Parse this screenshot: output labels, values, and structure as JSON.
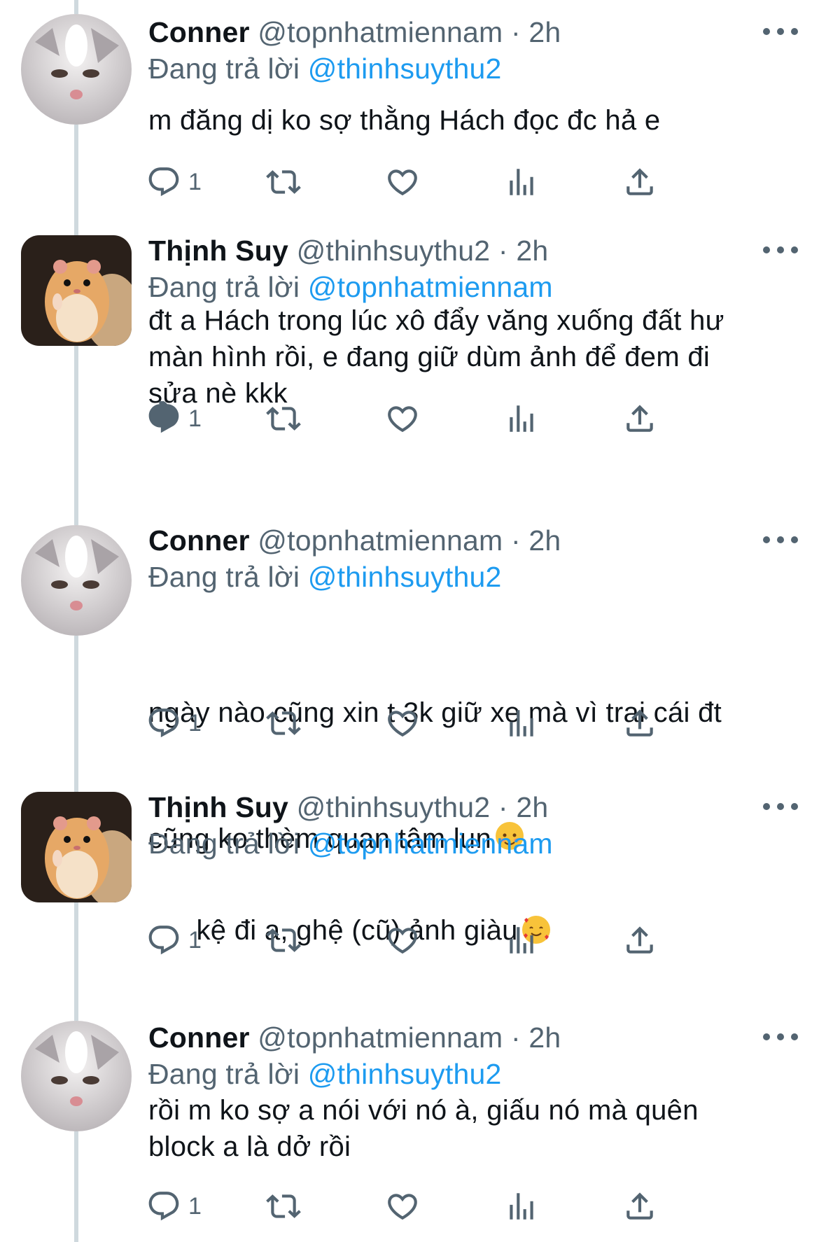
{
  "tweets": [
    {
      "name": "Conner",
      "handle": "@topnhatmiennam",
      "time": "2h",
      "reply_prefix": "Đang trả lời",
      "reply_to": "@thinhsuythu2",
      "text": "m đăng dị ko sợ thằng Hách đọc đc hả e",
      "reply_count": "1",
      "avatar": "cat-avatar"
    },
    {
      "name": "Thịnh Suy",
      "handle": "@thinhsuythu2",
      "time": "2h",
      "reply_prefix": "Đang trả lời",
      "reply_to": "@topnhatmiennam",
      "text": "đt a Hách trong lúc xô đẩy văng xuống đất hư\nmàn hình rồi, e đang giữ dùm ảnh để đem đi\nsửa nè kkk",
      "reply_count": "1",
      "avatar": "hamster-avatar"
    },
    {
      "name": "Conner",
      "handle": "@topnhatmiennam",
      "time": "2h",
      "reply_prefix": "Đang trả lời",
      "reply_to": "@thinhsuythu2",
      "text_line1": "ngày nào cũng xin t 3k giữ xe mà vì trai cái đt",
      "text_line2": "cũng ko thèm quan tâm lun",
      "emoji": "smiling-face-emoji",
      "reply_count": "1",
      "avatar": "cat-avatar"
    },
    {
      "name": "Thịnh Suy",
      "handle": "@thinhsuythu2",
      "time": "2h",
      "reply_prefix": "Đang trả lời",
      "reply_to": "@topnhatmiennam",
      "text": "kệ đi a, ghệ (cũ) ảnh giàu",
      "emoji": "smiling-face-with-hearts-emoji",
      "reply_count": "1",
      "avatar": "hamster-avatar"
    },
    {
      "name": "Conner",
      "handle": "@topnhatmiennam",
      "time": "2h",
      "reply_prefix": "Đang trả lời",
      "reply_to": "@thinhsuythu2",
      "text": "rồi m ko sợ a nói với nó à, giấu nó mà quên\nblock a là dở rồi",
      "reply_count": "1",
      "avatar": "cat-avatar"
    }
  ],
  "separator": "·",
  "icons": [
    "reply-icon",
    "retweet-icon",
    "like-icon",
    "views-icon",
    "share-icon",
    "more-icon"
  ],
  "colors": {
    "mention": "#1d9bf0",
    "secondary": "#536471",
    "text": "#0f1419",
    "thread_line": "#cfd9de"
  }
}
